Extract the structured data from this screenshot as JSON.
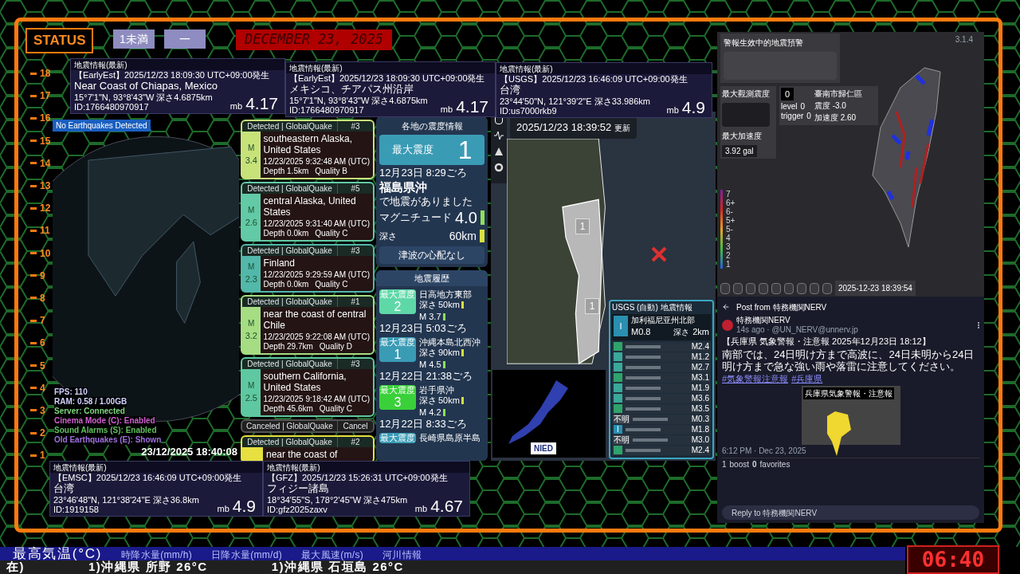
{
  "status": {
    "label": "STATUS",
    "badges": [
      "1未満",
      "一"
    ],
    "date": "DECEMBER 23, 2025"
  },
  "ruler": [
    "18",
    "17",
    "16",
    "15",
    "14",
    "13",
    "12",
    "11",
    "10",
    "9",
    "8",
    "7",
    "6",
    "5",
    "4",
    "3",
    "2",
    "1"
  ],
  "info_cards": [
    {
      "title": "地震情報(最新)",
      "source": "【EarlyEst】2025/12/23  18:09:30  UTC+09:00発生",
      "place": "Near Coast of Chiapas, Mexico",
      "coords": "15°7'1\"N,  93°8'43\"W   深さ4.6875km",
      "id": "ID:1766480970917",
      "scale": "mb",
      "magnitude": "4.17"
    },
    {
      "title": "地震情報(最新)",
      "source": "【EarlyEst】2025/12/23  18:09:30  UTC+09:00発生",
      "place": "メキシコ、チアパス州沿岸",
      "coords": "15°7'1\"N,  93°8'43\"W   深さ4.6875km",
      "id": "ID:1766480970917",
      "scale": "mb",
      "magnitude": "4.17"
    },
    {
      "title": "地震情報(最新)",
      "source": "【USGS】2025/12/23  16:46:09  UTC+09:00発生",
      "place": "台湾",
      "coords": "23°44'50\"N,  121°39'2\"E   深さ33.986km",
      "id": "ID:us7000rkb9",
      "scale": "mb",
      "magnitude": "4.9"
    },
    {
      "title": "地震情報(最新)",
      "source": "【EMSC】2025/12/23  16:46:09  UTC+09:00発生",
      "place": "台湾",
      "coords": "23°46'48\"N,  121°38'24\"E   深さ36.8km",
      "id": "ID:1919158",
      "scale": "mb",
      "magnitude": "4.9"
    },
    {
      "title": "地震情報(最新)",
      "source": "【GFZ】2025/12/23  15:26:31  UTC+09:00発生",
      "place": "フィジー諸島",
      "coords": "18°34'55\"S,  178°2'45\"W  深さ475km",
      "id": "ID:gfz2025zaxv",
      "scale": "mb",
      "magnitude": "4.67"
    }
  ],
  "globe": {
    "banner": "No Earthquakes Detected",
    "stats": [
      {
        "text": "FPS: 110",
        "color": "#d0d0ff"
      },
      {
        "text": "RAM: 0.58 / 1.00GB",
        "color": "#d0d0ff"
      },
      {
        "text": "Server: Connected",
        "color": "#7fd87f"
      },
      {
        "text": "Cinema Mode (C): Enabled",
        "color": "#d060d0"
      },
      {
        "text": "Sound Alarms (S): Enabled",
        "color": "#60c060"
      },
      {
        "text": "Old Earthquakes (E): Shown",
        "color": "#a070e0"
      }
    ],
    "timestamp": "23/12/2025 18:40:08"
  },
  "quake_list": [
    {
      "kind": "detected",
      "status": "Detected | GlobalQuake",
      "rank": "#3",
      "m_label": "M",
      "magnitude": "3.4",
      "region": "southeastern Alaska, United States",
      "time": "12/23/2025 9:32:48 AM (UTC)",
      "depth": "Depth 1.5km",
      "quality": "Quality B",
      "color": "#c8e27a"
    },
    {
      "kind": "detected",
      "status": "Detected | GlobalQuake",
      "rank": "#5",
      "m_label": "M",
      "magnitude": "2.6",
      "region": "central Alaska, United States",
      "time": "12/23/2025 9:31:40 AM (UTC)",
      "depth": "Depth 0.0km",
      "quality": "Quality C",
      "color": "#62caa6"
    },
    {
      "kind": "detected",
      "status": "Detected | GlobalQuake",
      "rank": "#3",
      "m_label": "M",
      "magnitude": "2.3",
      "region": "Finland",
      "time": "12/23/2025 9:29:59 AM (UTC)",
      "depth": "Depth 0.0km",
      "quality": "Quality C",
      "color": "#52b8aa"
    },
    {
      "kind": "detected",
      "status": "Detected | GlobalQuake",
      "rank": "#1",
      "m_label": "M",
      "magnitude": "3.2",
      "region": "near the coast of central Chile",
      "time": "12/23/2025 9:22:08 AM (UTC)",
      "depth": "Depth 29.7km",
      "quality": "Quality D",
      "color": "#a6dd82"
    },
    {
      "kind": "detected",
      "status": "Detected | GlobalQuake",
      "rank": "#3",
      "m_label": "M",
      "magnitude": "2.5",
      "region": "southern California, United States",
      "time": "12/23/2025 9:18:42 AM (UTC)",
      "depth": "Depth 45.6km",
      "quality": "Quality C",
      "color": "#5ec8a2"
    },
    {
      "kind": "canceled",
      "status": "Canceled | GlobalQuake",
      "rank": "Cancel",
      "color": "#555555"
    },
    {
      "kind": "partial",
      "status": "Detected | GlobalQuake",
      "rank": "#2",
      "region": "near the coast of",
      "color": "#e6e040"
    }
  ],
  "japan": {
    "header": "各地の震度情報",
    "max_label": "最大震度",
    "max_value": "1",
    "time": "12月23日 8:29ごろ",
    "place": "福島県沖",
    "note": "で地震がありました",
    "magnitude_label": "マグニチュード",
    "magnitude": "4.0",
    "depth_label": "深さ",
    "depth": "60km",
    "tsunami": "津波の心配なし",
    "history_header": "地震履歴",
    "history": [
      {
        "badge": "最大震度",
        "intensity": "2",
        "place": "日高地方東部",
        "time": "12月23日 5:03ごろ",
        "depth_label": "深さ",
        "depth": "50km",
        "magnitude": "M 3.7",
        "color": "#5fd8a8"
      },
      {
        "badge": "最大震度",
        "intensity": "1",
        "place": "沖縄本島北西沖",
        "time": "12月22日 21:38ごろ",
        "depth_label": "深さ",
        "depth": "90km",
        "magnitude": "M 4.5",
        "color": "#3a9bb5"
      },
      {
        "badge": "最大震度",
        "intensity": "3",
        "place": "岩手県沖",
        "time": "12月22日 8:33ごろ",
        "depth_label": "深さ",
        "depth": "50km",
        "magnitude": "M 4.2",
        "color": "#3ad03a"
      },
      {
        "badge": "最大震度",
        "place": "長崎県島原半島",
        "color": "#3a9bb5"
      }
    ]
  },
  "map": {
    "updated": "2025/12/23  18:39:52",
    "updated_suffix": "更新",
    "markers": [
      "1",
      "1"
    ],
    "nied_logo": "NIED"
  },
  "usgs": {
    "title": "USGS (自動) 地震情報",
    "intensity": "I",
    "place": "加利福尼亚州北部",
    "magnitude": "M0.8",
    "depth_label": "深さ",
    "depth": "2km",
    "rows": [
      {
        "magnitude": "M2.4",
        "color": "#2fa36b"
      },
      {
        "magnitude": "M1.2",
        "color": "#3aa89a"
      },
      {
        "magnitude": "M2.7",
        "color": "#3aa89a"
      },
      {
        "magnitude": "M3.1",
        "color": "#2fa36b"
      },
      {
        "magnitude": "M1.9",
        "color": "#3aa89a"
      },
      {
        "magnitude": "M3.6",
        "color": "#3aa89a"
      },
      {
        "magnitude": "M3.5",
        "color": "#2fa36b"
      },
      {
        "magnitude": "M0.3",
        "badge": "不明",
        "color": "#444c55"
      },
      {
        "magnitude": "M1.8",
        "badge": "I",
        "color": "#2a8fb0"
      },
      {
        "magnitude": "M3.0",
        "badge": "不明",
        "color": "#444c55"
      },
      {
        "magnitude": "M2.4",
        "color": "#2fa36b"
      }
    ]
  },
  "taiwan": {
    "title": "警報生效中的地震預警",
    "max_intensity_label": "最大觀測震度",
    "station_value": "0",
    "station_name": "臺南市歸仁區",
    "station_intensity": "震度 -3.0",
    "station_accel": "加速度 2.60",
    "level_label": "level",
    "level_value": "0",
    "trigger_label": "trigger",
    "trigger_value": "0",
    "max_accel_label": "最大加速度",
    "max_accel": "3.92 gal",
    "version": "3.1.4",
    "scale": [
      "7",
      "6+",
      "6-",
      "5+",
      "5-",
      "4",
      "3",
      "2",
      "1"
    ],
    "timestamp": "2025-12-23 18:39:54"
  },
  "post": {
    "header": "Post from 特務機関NERV",
    "author": "特務機関NERV",
    "meta": "14s ago · @UN_NERV@unnerv.jp",
    "title": "【兵庫県 気象警報・注意報 2025年12月23日 18:12】",
    "body": "南部では、24日明け方まで高波に、24日未明から24日明け方まで急な強い雨や落雷に注意してください。",
    "tags": [
      "#気象警報注意報",
      "#兵庫県"
    ],
    "image_title": "兵庫県気象警報・注意報",
    "time": "6:12 PM · Dec 23, 2025",
    "boosts": "1",
    "boosts_label": "boost",
    "favorites": "0",
    "favorites_label": "favorites",
    "reply_placeholder": "Reply to 特務機関NERV"
  },
  "ticker": {
    "headlines": [
      {
        "label": "最高気温(°C)",
        "selected": true
      },
      {
        "label": "時降水量(mm/h)",
        "selected": false
      },
      {
        "label": "日降水量(mm/d)",
        "selected": false
      },
      {
        "label": "最大風速(m/s)",
        "selected": false
      },
      {
        "label": "河川情報",
        "selected": false
      }
    ],
    "items": [
      "在)",
      "1)沖縄県 所野 26°C",
      "1)沖縄県 石垣島 26°C"
    ],
    "clock": "06:40"
  }
}
